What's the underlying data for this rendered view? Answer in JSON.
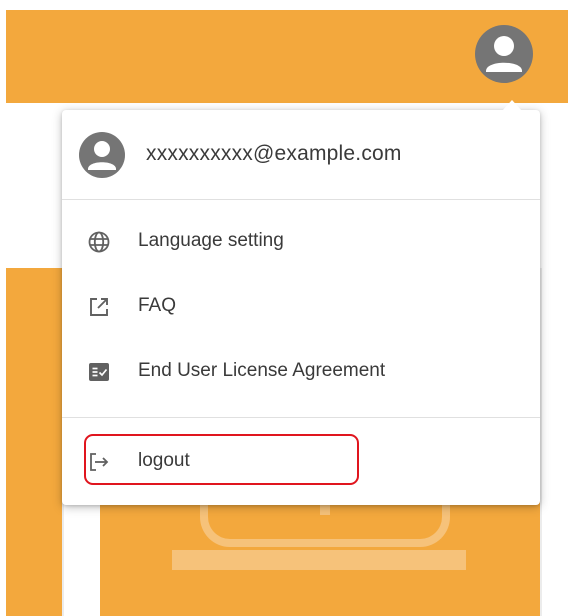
{
  "user": {
    "email": "xxxxxxxxxx@example.com"
  },
  "menu": {
    "items": [
      {
        "label": "Language setting",
        "icon": "globe-icon"
      },
      {
        "label": "FAQ",
        "icon": "open-external-icon"
      },
      {
        "label": "End User License Agreement",
        "icon": "license-icon"
      }
    ],
    "logout": {
      "label": "logout",
      "icon": "logout-icon"
    }
  },
  "colors": {
    "header": "#f3a83d",
    "avatar": "#757575",
    "highlight": "#e0151e",
    "text": "#3a3a3a",
    "icon": "#616161"
  }
}
